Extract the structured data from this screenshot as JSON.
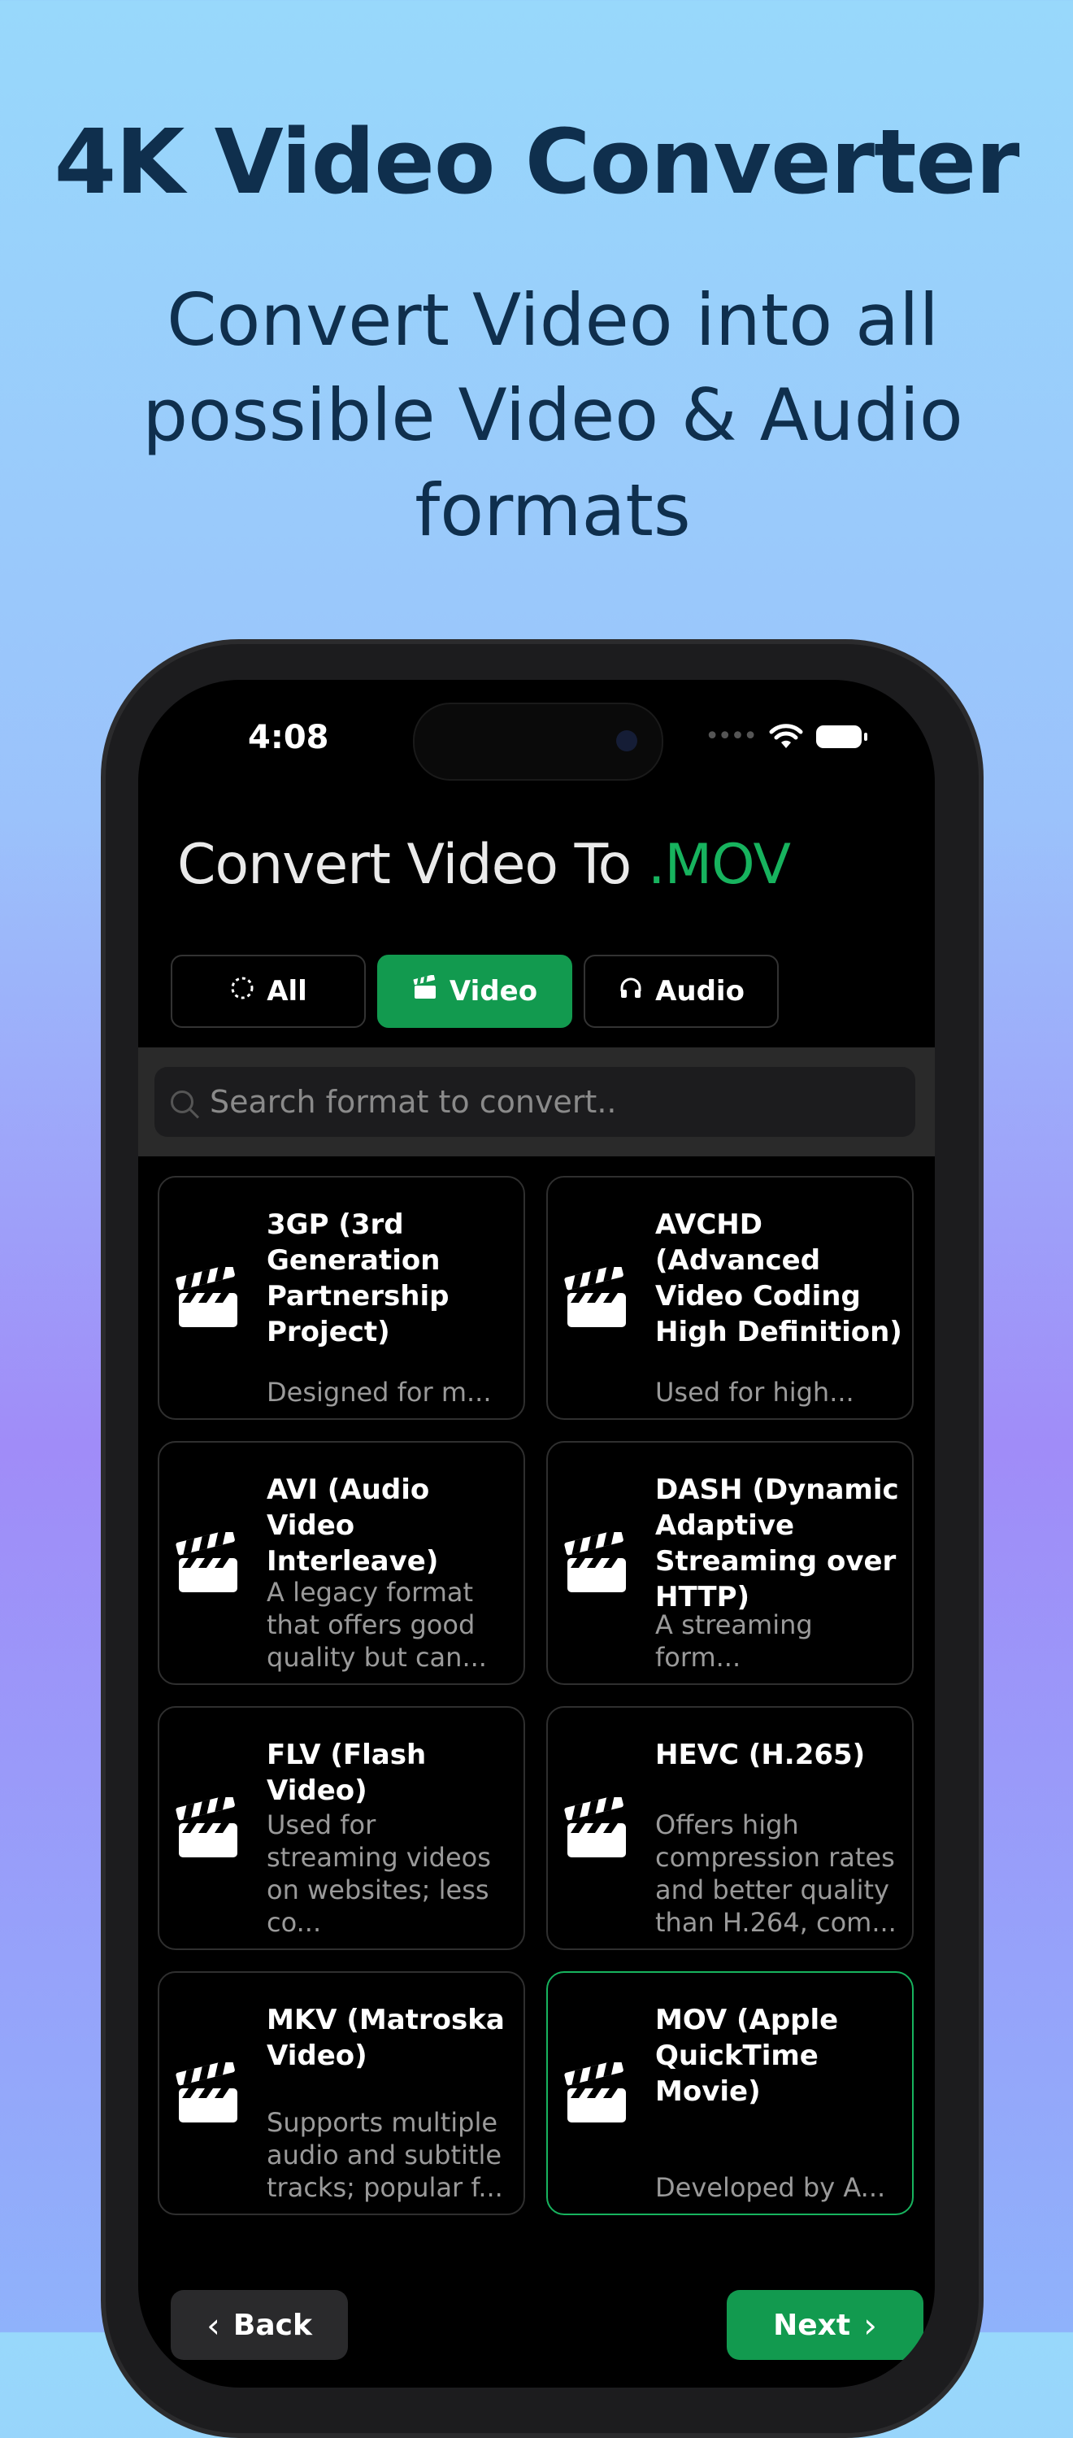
{
  "hero": {
    "title": "4K Video Converter",
    "subtitle": "Convert Video into all possible Video & Audio formats"
  },
  "status": {
    "time": "4:08"
  },
  "page": {
    "title_prefix": "Convert Video To ",
    "title_accent": ".MOV",
    "accent_color": "#17b35e"
  },
  "tabs": [
    {
      "label": "All",
      "icon": "circle-dashed-icon",
      "active": false
    },
    {
      "label": "Video",
      "icon": "clapperboard-icon",
      "active": true
    },
    {
      "label": "Audio",
      "icon": "headphones-icon",
      "active": false
    }
  ],
  "search": {
    "placeholder": "Search format to convert.."
  },
  "formats": [
    {
      "name": "3GP (3rd Generation Partnership Project)",
      "desc": "Designed for m...",
      "selected": false
    },
    {
      "name": "AVCHD (Advanced Video Coding High Definition)",
      "desc": "Used for high...",
      "selected": false
    },
    {
      "name": "AVI (Audio Video Interleave)",
      "desc": "A legacy format that offers good quality but can...",
      "selected": false
    },
    {
      "name": "DASH (Dynamic Adaptive Streaming over HTTP)",
      "desc": "A streaming form...",
      "selected": false
    },
    {
      "name": "FLV (Flash Video)",
      "desc": "Used for streaming videos on websites; less co...",
      "selected": false
    },
    {
      "name": "HEVC (H.265)",
      "desc": "Offers high compression rates and better quality than H.264, com...",
      "selected": false
    },
    {
      "name": "MKV (Matroska Video)",
      "desc": "Supports multiple audio and subtitle tracks; popular f...",
      "selected": false
    },
    {
      "name": "MOV (Apple QuickTime Movie)",
      "desc": "Developed by A...",
      "selected": true
    }
  ],
  "buttons": {
    "back": "Back",
    "next": "Next"
  }
}
